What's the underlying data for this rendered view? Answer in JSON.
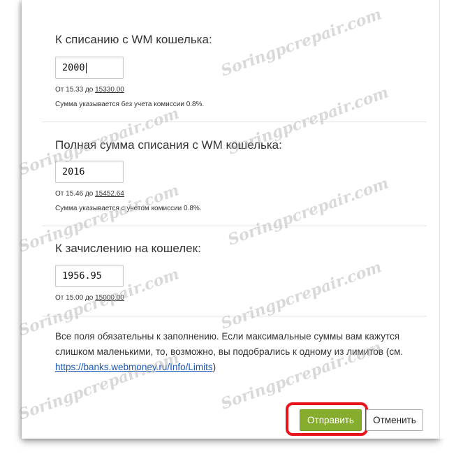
{
  "debit": {
    "title": "К списанию с WM кошелька:",
    "value": "2000",
    "range_prefix": "От 15.33 до",
    "range_max": "15330.00",
    "note": "Сумма указывается без учета комиссии 0.8%."
  },
  "total": {
    "title": "Полная сумма списания с WM кошелька:",
    "value": "2016",
    "range_prefix": "От 15.46 до",
    "range_max": "15452.64",
    "note": "Сумма указывается с учетом комиссии 0.8%."
  },
  "credit": {
    "title": "К зачислению на кошелек:",
    "value": "1956.95",
    "range_prefix": "От 15.00 до",
    "range_max": "15000.00"
  },
  "info": {
    "text_before": "Все поля обязательны к заполнению. Если максимальные суммы вам кажутся слишком маленькими, то, возможно, вы подобрались к одному из лимитов (см. ",
    "link": "https://banks.webmoney.ru/Info/Limits",
    "text_after": ")"
  },
  "buttons": {
    "submit": "Отправить",
    "cancel": "Отменить"
  },
  "watermark": "Soringpcrepair.com"
}
